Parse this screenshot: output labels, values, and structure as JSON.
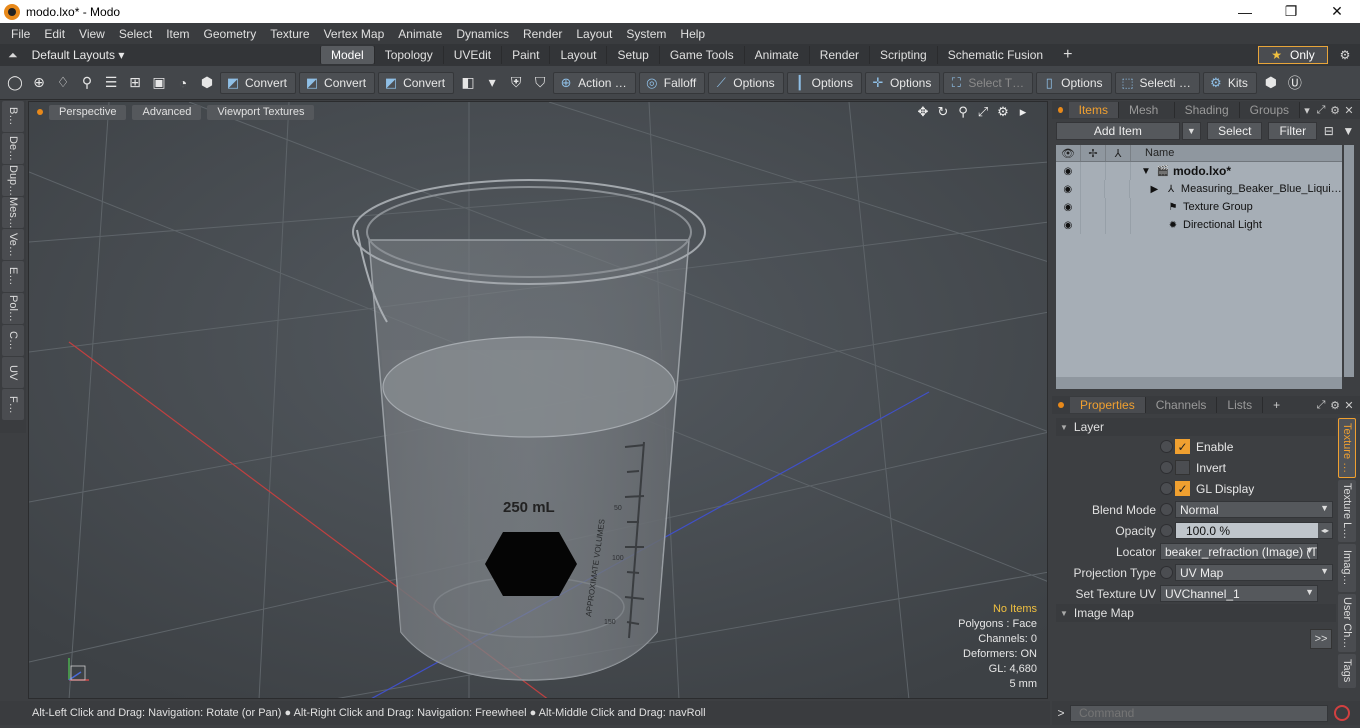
{
  "window": {
    "title": "modo.lxo* - Modo",
    "min": "—",
    "max": "❐",
    "close": "✕"
  },
  "menu": [
    "File",
    "Edit",
    "View",
    "Select",
    "Item",
    "Geometry",
    "Texture",
    "Vertex Map",
    "Animate",
    "Dynamics",
    "Render",
    "Layout",
    "System",
    "Help"
  ],
  "layout": {
    "selector": "Default Layouts ▾",
    "tabs": [
      "Model",
      "Topology",
      "UVEdit",
      "Paint",
      "Layout",
      "Setup",
      "Game Tools",
      "Animate",
      "Render",
      "Scripting",
      "Schematic Fusion"
    ],
    "active_tab": "Model",
    "only_label": "Only"
  },
  "toolbar": {
    "convert_1": "Convert",
    "convert_2": "Convert",
    "convert_3": "Convert",
    "action": "Action  …",
    "falloff": "Falloff",
    "options_1": "Options",
    "options_2": "Options",
    "options_3": "Options",
    "options_4": "Options",
    "select_t": "Select T…",
    "selecti": "Selecti …",
    "kits": "Kits"
  },
  "left_tabs": [
    "B…",
    "De…",
    "Dup…",
    "Mes…",
    "Ve…",
    "E…",
    "Pol…",
    "C…",
    "UV",
    "F…"
  ],
  "viewport": {
    "buttons": [
      "Perspective",
      "Advanced",
      "Viewport Textures"
    ],
    "beaker_label": "250 mL",
    "beaker_side_text": "APPROXIMATE VOLUMES",
    "graduations": [
      "50",
      "100",
      "150"
    ],
    "info": {
      "no_items": "No Items",
      "polygons": "Polygons : Face",
      "channels": "Channels: 0",
      "deformers": "Deformers: ON",
      "gl": "GL: 4,680",
      "scale": "5 mm"
    }
  },
  "status": "Alt-Left Click and Drag: Navigation: Rotate (or Pan) ● Alt-Right Click and Drag: Navigation: Freewheel ● Alt-Middle Click and Drag: navRoll",
  "items_panel": {
    "tabs": [
      "Items",
      "Mesh …",
      "Shading",
      "Groups"
    ],
    "active_tab": "Items",
    "add_item": "Add Item",
    "select": "Select",
    "filter": "Filter",
    "column_name": "Name",
    "rows": [
      {
        "label": "modo.lxo*",
        "visible": true
      },
      {
        "label": "Measuring_Beaker_Blue_Liqui …",
        "visible": true
      },
      {
        "label": "Texture Group",
        "visible": true
      },
      {
        "label": "Directional Light",
        "visible": true
      }
    ]
  },
  "properties_panel": {
    "tabs": [
      "Properties",
      "Channels",
      "Lists"
    ],
    "active_tab": "Properties",
    "section_layer": "Layer",
    "enable": "Enable",
    "invert": "Invert",
    "gl_display": "GL Display",
    "blend_mode_label": "Blend Mode",
    "blend_mode": "Normal",
    "opacity_label": "Opacity",
    "opacity": "100.0 %",
    "locator_label": "Locator",
    "locator": "beaker_refraction (Image) (T…",
    "projection_label": "Projection Type",
    "projection": "UV Map",
    "set_uv_label": "Set Texture UV",
    "set_uv": "UVChannel_1",
    "section_image_map": "Image Map",
    "more": ">>",
    "side_tabs": [
      "Texture …",
      "Texture L…",
      "Imag…",
      "User Ch…",
      "Tags"
    ]
  },
  "command": {
    "prompt": ">",
    "placeholder": "Command"
  },
  "colors": {
    "accent": "#f0a030",
    "viewport_bg": "#464a4e",
    "tree_bg": "#a6aeb6"
  }
}
